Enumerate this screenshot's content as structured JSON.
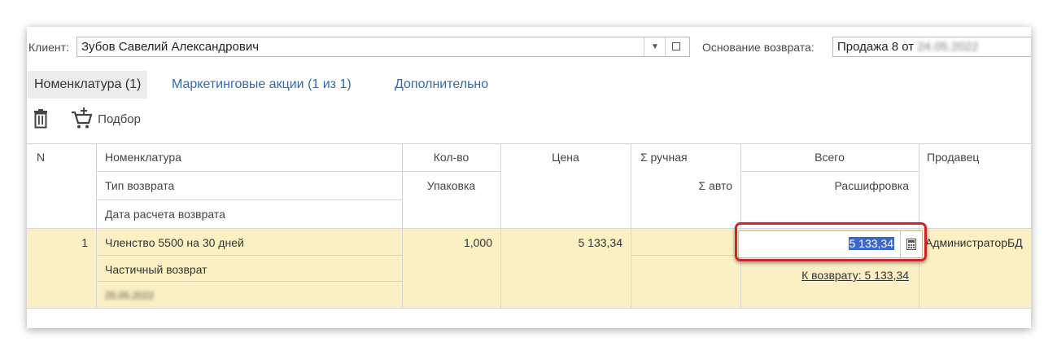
{
  "header": {
    "client_label": "Клиент:",
    "client_value": "Зубов Савелий Александрович",
    "basis_label": "Основание возврата:",
    "basis_value": "Продажа 8 от",
    "basis_value_blurred": "24.05.2022"
  },
  "tabs": [
    {
      "label": "Номенклатура (1)"
    },
    {
      "label": "Маркетинговые акции (1 из 1)"
    },
    {
      "label": "Дополнительно"
    }
  ],
  "toolbar": {
    "pick_label": "Подбор"
  },
  "table": {
    "headers": {
      "n": "N",
      "nomenclature": "Номенклатура",
      "return_type": "Тип возврата",
      "calc_date": "Дата расчета возврата",
      "qty": "Кол-во",
      "package": "Упаковка",
      "price": "Цена",
      "sum_manual": "Σ ручная",
      "sum_auto": "Σ авто",
      "total": "Всего",
      "breakdown": "Расшифровка",
      "seller": "Продавец"
    },
    "rows": [
      {
        "n": "1",
        "nomenclature": "Членство 5500 на 30 дней",
        "return_type": "Частичный возврат",
        "calc_date": "25.05.2022",
        "qty": "1,000",
        "price": "5 133,34",
        "total": "5 133,34",
        "breakdown_link": "К возврату: 5 133,34",
        "seller": "АдминистраторБД"
      }
    ]
  },
  "colors": {
    "selected_row": "#fbf0c3",
    "link": "#2e6bb4",
    "highlight_ring": "#c9252c",
    "text_selection": "#3b67c8"
  }
}
